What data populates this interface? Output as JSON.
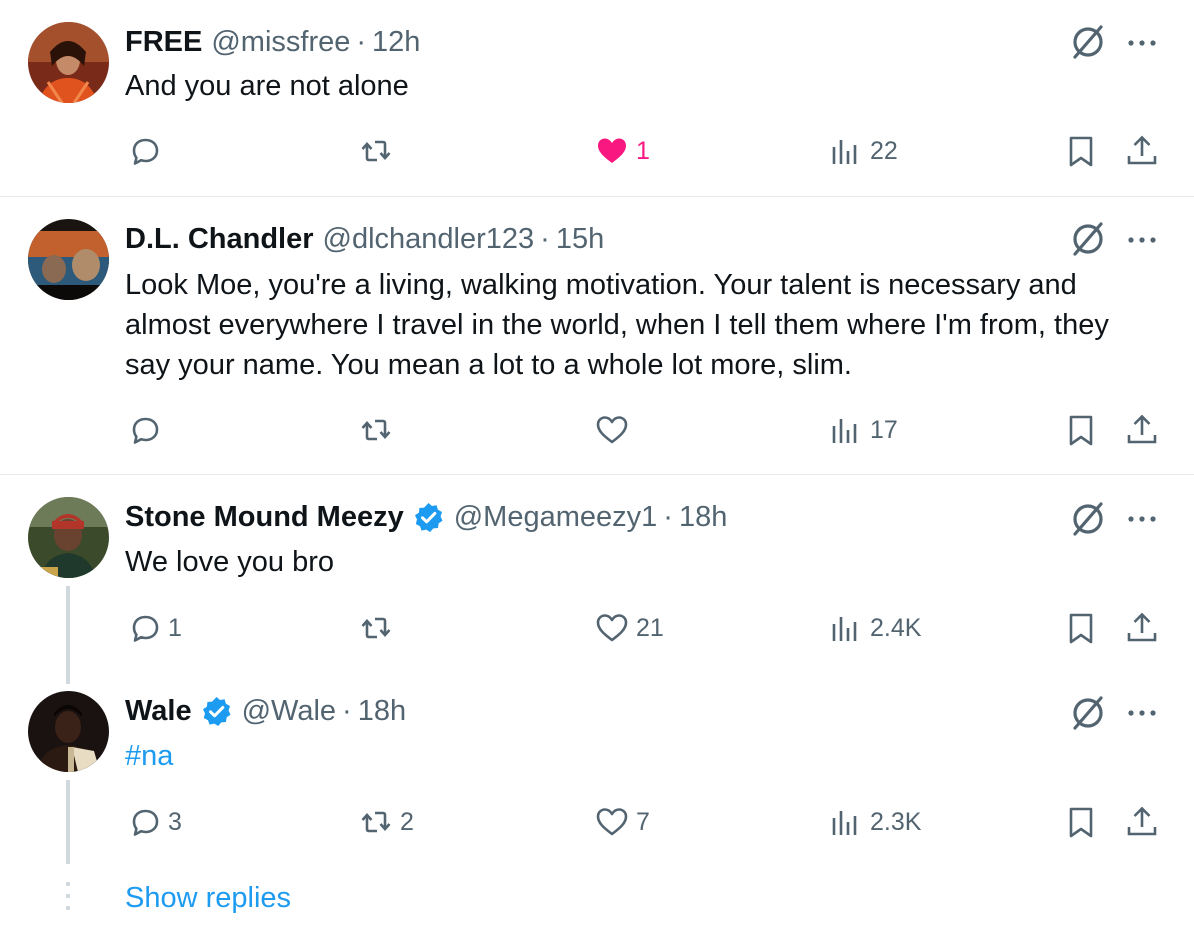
{
  "tweets": [
    {
      "name": "FREE",
      "handle": "@missfree",
      "separator": "·",
      "time": "12h",
      "verified": false,
      "text": "And you are not alone",
      "replies": "",
      "retweets": "",
      "likes": "1",
      "liked": true,
      "views": "22"
    },
    {
      "name": "D.L. Chandler",
      "handle": "@dlchandler123",
      "separator": "·",
      "time": "15h",
      "verified": false,
      "text": "Look Moe, you're a living, walking motivation. Your talent is necessary and almost everywhere I travel in the world, when I tell them where I'm from, they say your name. You mean a lot to a whole lot more, slim.",
      "replies": "",
      "retweets": "",
      "likes": "",
      "liked": false,
      "views": "17"
    },
    {
      "name": "Stone Mound Meezy",
      "handle": "@Megameezy1",
      "separator": "·",
      "time": "18h",
      "verified": true,
      "text": "We love you bro",
      "replies": "1",
      "retweets": "",
      "likes": "21",
      "liked": false,
      "views": "2.4K"
    },
    {
      "name": "Wale",
      "handle": "@Wale",
      "separator": "·",
      "time": "18h",
      "verified": true,
      "text": "#na",
      "replies": "3",
      "retweets": "2",
      "likes": "7",
      "liked": false,
      "views": "2.3K"
    }
  ],
  "show_replies": "Show replies",
  "icons": {
    "reply": "speech-bubble-icon",
    "retweet": "retweet-arrows-icon",
    "like": "heart-icon",
    "views": "bar-chart-icon",
    "bookmark": "bookmark-icon",
    "share": "share-upload-icon",
    "grok": "grok-slash-circle-icon",
    "more": "ellipsis-icon",
    "verified": "verified-badge-icon"
  },
  "colors": {
    "text_primary": "#0f1419",
    "text_secondary": "#536471",
    "link": "#1d9bf0",
    "like_active": "#f91880",
    "verified": "#1d9bf0",
    "divider": "#e6e8ea"
  }
}
